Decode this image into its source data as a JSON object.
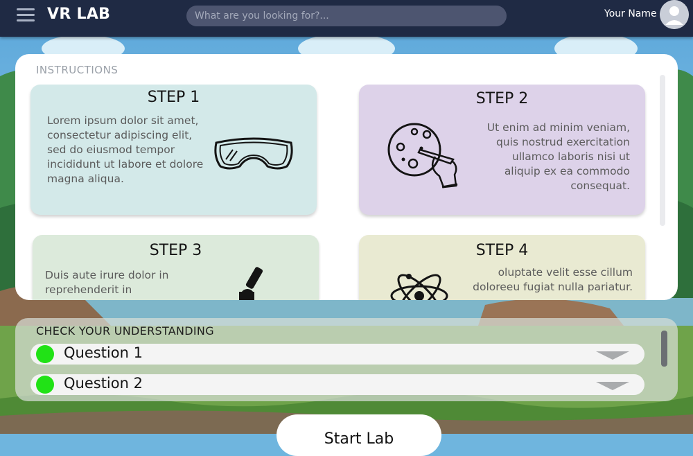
{
  "app": {
    "title": "VR LAB"
  },
  "search": {
    "placeholder": "What are you looking for?..."
  },
  "user": {
    "name": "Your Name"
  },
  "instructions": {
    "heading": "INSTRUCTIONS",
    "steps": [
      {
        "title": "STEP 1",
        "text": "Lorem ipsum dolor sit amet, consectetur adipiscing elit, sed do eiusmod tempor incididunt ut labore et dolore magna aliqua.",
        "icon": "safety-goggles-icon",
        "color": "#d3e9e9"
      },
      {
        "title": "STEP 2",
        "text": "Ut enim ad minim veniam, quis nostrud exercitation ullamco laboris nisi ut aliquip ex ea commodo consequat.",
        "icon": "petri-dish-icon",
        "color": "#ddd2e9"
      },
      {
        "title": "STEP 3",
        "text": "Duis aute irure dolor in reprehenderit in",
        "icon": "microscope-icon",
        "color": "#dceadb"
      },
      {
        "title": "STEP 4",
        "text": "oluptate velit esse cillum doloreeu fugiat nulla pariatur.",
        "icon": "atom-icon",
        "color": "#e9ead2"
      }
    ]
  },
  "check": {
    "heading": "CHECK YOUR UNDERSTANDING",
    "questions": [
      {
        "label": "Question 1",
        "status_color": "#21e216"
      },
      {
        "label": "Question 2",
        "status_color": "#21e216"
      }
    ]
  },
  "start": {
    "label": "Start Lab"
  },
  "colors": {
    "topbar": "#1f2a44",
    "status_green": "#21e216"
  }
}
